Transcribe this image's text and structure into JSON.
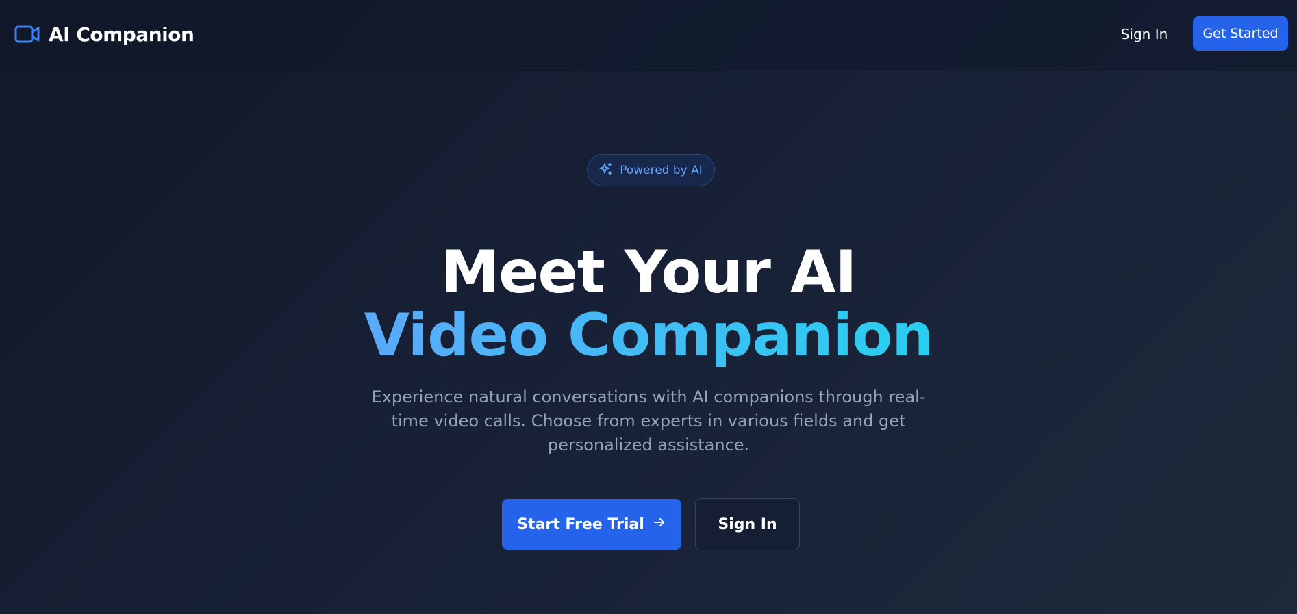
{
  "header": {
    "brand_icon": "video-camera-icon",
    "brand_name": "AI Companion",
    "sign_in_label": "Sign In",
    "get_started_label": "Get Started"
  },
  "hero": {
    "badge_icon": "sparkles-icon",
    "badge_label": "Powered by AI",
    "title_line1": "Meet Your AI",
    "title_line2": "Video Companion",
    "subtitle": "Experience natural conversations with AI companions through real-time video calls. Choose from experts in various fields and get personalized assistance.",
    "primary_cta_label": "Start Free Trial",
    "primary_cta_icon": "arrow-right-icon",
    "secondary_cta_label": "Sign In"
  },
  "colors": {
    "accent": "#2563eb",
    "badge_text": "#60a5fa",
    "gradient_start": "#60a5fa",
    "gradient_end": "#22d3ee",
    "subtitle_text": "#94a3b8",
    "background": "#111827"
  }
}
